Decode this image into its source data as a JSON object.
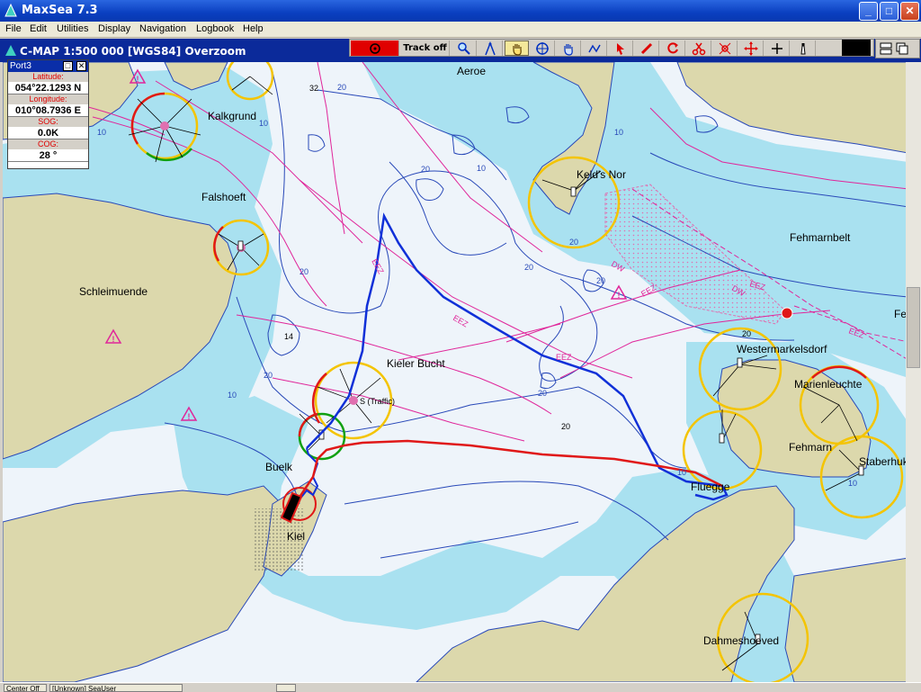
{
  "window": {
    "title": "MaxSea 7.3",
    "controls": {
      "minimize": "_",
      "maximize": "□",
      "close": "✕"
    }
  },
  "menu": [
    "File",
    "Edit",
    "Utilities",
    "Display",
    "Navigation",
    "Logbook",
    "Help"
  ],
  "chart_header": {
    "title": "C-MAP  1:500 000 [WGS84]    Overzoom",
    "colors": {
      "bar": "#0b2a9a",
      "text": "#ffffff"
    }
  },
  "toolbar": {
    "track_label": "Track off",
    "tools": [
      "record-target-icon",
      "zoom-icon",
      "compass-icon",
      "hand-icon",
      "crosshair-icon",
      "pan-hand-icon",
      "route-icon",
      "pointer-icon",
      "pencil-icon",
      "rotate-icon",
      "scissors-icon",
      "waypoint-icon",
      "move-icon",
      "plus-icon",
      "lighthouse-icon"
    ]
  },
  "port_panel": {
    "title": "Port3",
    "latitude_label": "Latitude:",
    "latitude": "054°22.1293 N",
    "longitude_label": "Longitude:",
    "longitude": "010°08.7936 E",
    "sog_label": "SOG:",
    "sog": "0.0K",
    "cog_label": "COG:",
    "cog": "28 °"
  },
  "map": {
    "colors": {
      "land": "#dcd8ac",
      "deep_water": "#eef4fa",
      "shallow_water": "#a9e1f0",
      "depth_contour": "#2848b8",
      "boundary": "#e0269a",
      "track_blue": "#1030d8",
      "track_red": "#e01818",
      "light_yellow": "#f4c400"
    },
    "place_names": [
      "Aeroe",
      "Kalkgrund",
      "Keld's Nor",
      "Falshoeft",
      "Fehmarnbelt",
      "Schleimuende",
      "Fe",
      "Westermarkelsdorf",
      "Kieler Bucht",
      "Marienleuchte",
      "Fehmarn",
      "Staberhuk",
      "Buelk",
      "Fluegge",
      "Kiel",
      "Dahmeshoeved"
    ],
    "depth_labels": [
      "32",
      "20",
      "10",
      "10",
      "20",
      "20",
      "10",
      "20",
      "10",
      "14",
      "20",
      "20",
      "10",
      "20",
      "20",
      "20",
      "10",
      "20",
      "10"
    ],
    "zone_labels": [
      "EEZ",
      "EEZ",
      "EEZ",
      "EEZ",
      "DW",
      "DW",
      "EEZ",
      "EEZ"
    ],
    "target_label": "S (Traffic)"
  },
  "statusbar": {
    "item1": "Center Off",
    "item2": "[Unknown] SeaUser"
  }
}
